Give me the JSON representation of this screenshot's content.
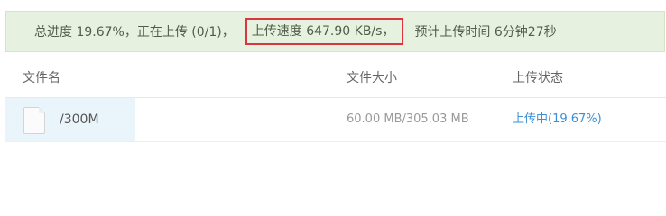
{
  "banner": {
    "progress_text": "总进度 19.67%，正在上传 (0/1)，",
    "speed_text": "上传速度 647.90 KB/s，",
    "eta_text": "预计上传时间 6分钟27秒"
  },
  "columns": {
    "name": "文件名",
    "size": "文件大小",
    "status": "上传状态"
  },
  "files": [
    {
      "icon": "file-icon",
      "name": "/300M",
      "size": "60.00 MB/305.03 MB",
      "status": "上传中(19.67%)",
      "progress": 0.1967
    }
  ],
  "colors": {
    "banner_background": "#e6f2df",
    "highlight_border": "#d9363e",
    "status_link": "#3b8fd8",
    "row_highlight": "#eaf4fb"
  }
}
